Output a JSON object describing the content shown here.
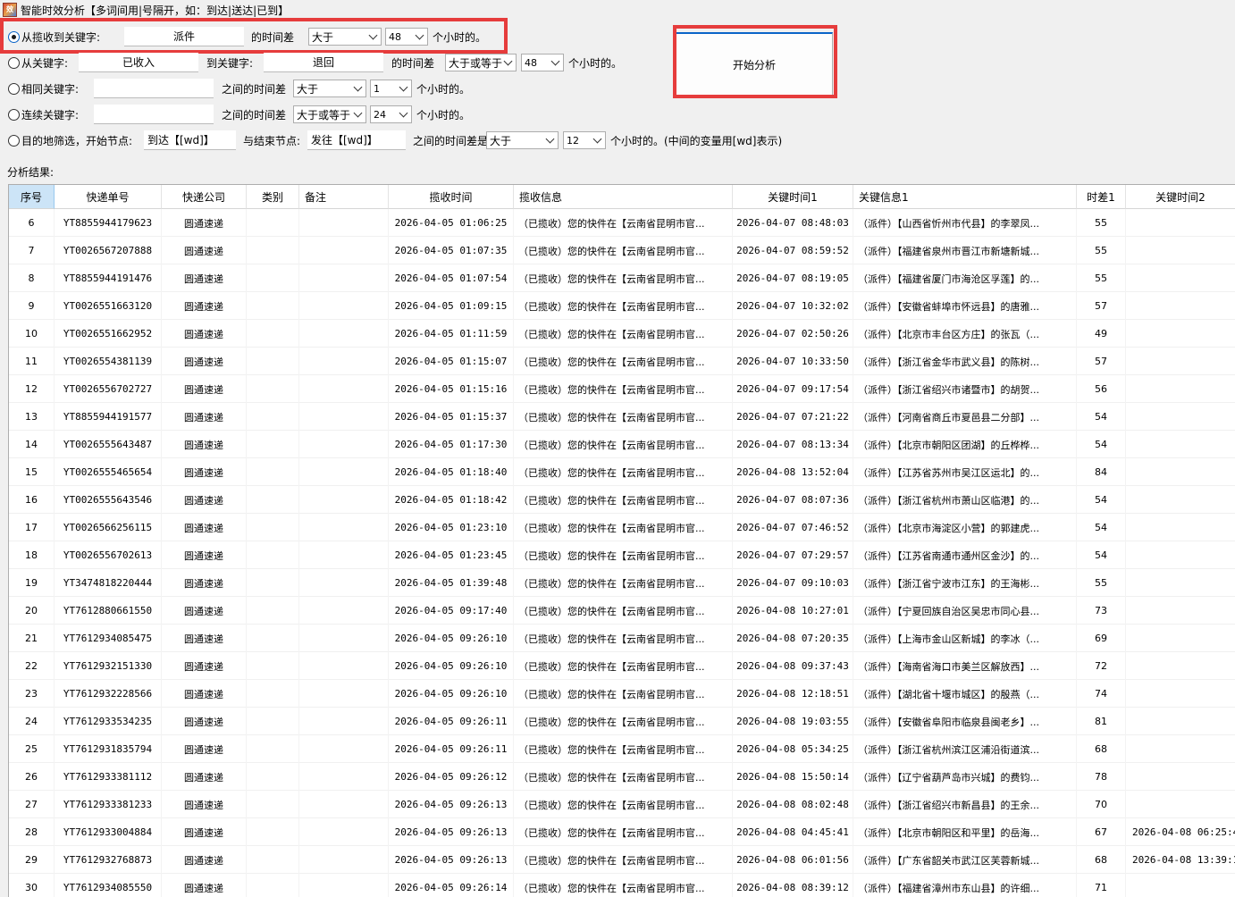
{
  "window": {
    "title": "智能时效分析【多词间用|号隔开，如：到达|送达|已到】",
    "icon_text": "效"
  },
  "row1": {
    "label": "从揽收到关键字:",
    "keyword": "派件",
    "diff_label": "的时间差",
    "op": "大于",
    "hours": "48",
    "unit": "个小时的。",
    "checked": true
  },
  "row2": {
    "label": "从关键字:",
    "from_keyword": "已收入",
    "to_label": "到关键字:",
    "to_keyword": "退回",
    "diff_label": "的时间差",
    "op": "大于或等于",
    "hours": "48",
    "unit": "个小时的。",
    "checked": false
  },
  "row3": {
    "label": "相同关键字:",
    "keyword": "",
    "diff_label": "之间的时间差",
    "op": "大于",
    "hours": "1",
    "unit": "个小时的。",
    "checked": false
  },
  "row4": {
    "label": "连续关键字:",
    "keyword": "",
    "diff_label": "之间的时间差",
    "op": "大于或等于",
    "hours": "24",
    "unit": "个小时的。",
    "checked": false
  },
  "row5": {
    "label": "目的地筛选，开始节点:",
    "start_node": "到达【[wd]】",
    "end_label": "与结束节点:",
    "end_node": "发往【[wd]】",
    "diff_label": "之间的时间差是",
    "op": "大于",
    "hours": "12",
    "unit": "个小时的。(中间的变量用[wd]表示)",
    "checked": false
  },
  "start_button": "开始分析",
  "results_label": "分析结果:",
  "columns": [
    "序号",
    "快递单号",
    "快递公司",
    "类别",
    "备注",
    "揽收时间",
    "揽收信息",
    "关键时间1",
    "关键信息1",
    "时差1",
    "关键时间2"
  ],
  "rows": [
    [
      "6",
      "YT8855944179623",
      "圆通速递",
      "",
      "",
      "2026-04-05 01:06:25",
      "（已揽收）您的快件在【云南省昆明市官...",
      "2026-04-07 08:48:03",
      "（派件）【山西省忻州市代县】的李翠凤...",
      "55",
      ""
    ],
    [
      "7",
      "YT0026567207888",
      "圆通速递",
      "",
      "",
      "2026-04-05 01:07:35",
      "（已揽收）您的快件在【云南省昆明市官...",
      "2026-04-07 08:59:52",
      "（派件）【福建省泉州市晋江市新塘新城...",
      "55",
      ""
    ],
    [
      "8",
      "YT8855944191476",
      "圆通速递",
      "",
      "",
      "2026-04-05 01:07:54",
      "（已揽收）您的快件在【云南省昆明市官...",
      "2026-04-07 08:19:05",
      "（派件）【福建省厦门市海沧区孚莲】的...",
      "55",
      ""
    ],
    [
      "9",
      "YT0026551663120",
      "圆通速递",
      "",
      "",
      "2026-04-05 01:09:15",
      "（已揽收）您的快件在【云南省昆明市官...",
      "2026-04-07 10:32:02",
      "（派件）【安徽省蚌埠市怀远县】的唐雅...",
      "57",
      ""
    ],
    [
      "10",
      "YT0026551662952",
      "圆通速递",
      "",
      "",
      "2026-04-05 01:11:59",
      "（已揽收）您的快件在【云南省昆明市官...",
      "2026-04-07 02:50:26",
      "（派件）【北京市丰台区方庄】的张瓦（...",
      "49",
      ""
    ],
    [
      "11",
      "YT0026554381139",
      "圆通速递",
      "",
      "",
      "2026-04-05 01:15:07",
      "（已揽收）您的快件在【云南省昆明市官...",
      "2026-04-07 10:33:50",
      "（派件）【浙江省金华市武义县】的陈树...",
      "57",
      ""
    ],
    [
      "12",
      "YT0026556702727",
      "圆通速递",
      "",
      "",
      "2026-04-05 01:15:16",
      "（已揽收）您的快件在【云南省昆明市官...",
      "2026-04-07 09:17:54",
      "（派件）【浙江省绍兴市诸暨市】的胡贺...",
      "56",
      ""
    ],
    [
      "13",
      "YT8855944191577",
      "圆通速递",
      "",
      "",
      "2026-04-05 01:15:37",
      "（已揽收）您的快件在【云南省昆明市官...",
      "2026-04-07 07:21:22",
      "（派件）【河南省商丘市夏邑县二分部】...",
      "54",
      ""
    ],
    [
      "14",
      "YT0026555643487",
      "圆通速递",
      "",
      "",
      "2026-04-05 01:17:30",
      "（已揽收）您的快件在【云南省昆明市官...",
      "2026-04-07 08:13:34",
      "（派件）【北京市朝阳区团湖】的丘桦桦...",
      "54",
      ""
    ],
    [
      "15",
      "YT0026555465654",
      "圆通速递",
      "",
      "",
      "2026-04-05 01:18:40",
      "（已揽收）您的快件在【云南省昆明市官...",
      "2026-04-08 13:52:04",
      "（派件）【江苏省苏州市吴江区运北】的...",
      "84",
      ""
    ],
    [
      "16",
      "YT0026555643546",
      "圆通速递",
      "",
      "",
      "2026-04-05 01:18:42",
      "（已揽收）您的快件在【云南省昆明市官...",
      "2026-04-07 08:07:36",
      "（派件）【浙江省杭州市萧山区临港】的...",
      "54",
      ""
    ],
    [
      "17",
      "YT0026566256115",
      "圆通速递",
      "",
      "",
      "2026-04-05 01:23:10",
      "（已揽收）您的快件在【云南省昆明市官...",
      "2026-04-07 07:46:52",
      "（派件）【北京市海淀区小营】的郭建虎...",
      "54",
      ""
    ],
    [
      "18",
      "YT0026556702613",
      "圆通速递",
      "",
      "",
      "2026-04-05 01:23:45",
      "（已揽收）您的快件在【云南省昆明市官...",
      "2026-04-07 07:29:57",
      "（派件）【江苏省南通市通州区金沙】的...",
      "54",
      ""
    ],
    [
      "19",
      "YT3474818220444",
      "圆通速递",
      "",
      "",
      "2026-04-05 01:39:48",
      "（已揽收）您的快件在【云南省昆明市官...",
      "2026-04-07 09:10:03",
      "（派件）【浙江省宁波市江东】的王海彬...",
      "55",
      ""
    ],
    [
      "20",
      "YT7612880661550",
      "圆通速递",
      "",
      "",
      "2026-04-05 09:17:40",
      "（已揽收）您的快件在【云南省昆明市官...",
      "2026-04-08 10:27:01",
      "（派件）【宁夏回族自治区吴忠市同心县...",
      "73",
      ""
    ],
    [
      "21",
      "YT7612934085475",
      "圆通速递",
      "",
      "",
      "2026-04-05 09:26:10",
      "（已揽收）您的快件在【云南省昆明市官...",
      "2026-04-08 07:20:35",
      "（派件）【上海市金山区新城】的李冰（...",
      "69",
      ""
    ],
    [
      "22",
      "YT7612932151330",
      "圆通速递",
      "",
      "",
      "2026-04-05 09:26:10",
      "（已揽收）您的快件在【云南省昆明市官...",
      "2026-04-08 09:37:43",
      "（派件）【海南省海口市美兰区解放西】...",
      "72",
      ""
    ],
    [
      "23",
      "YT7612932228566",
      "圆通速递",
      "",
      "",
      "2026-04-05 09:26:10",
      "（已揽收）您的快件在【云南省昆明市官...",
      "2026-04-08 12:18:51",
      "（派件）【湖北省十堰市城区】的殷燕（...",
      "74",
      ""
    ],
    [
      "24",
      "YT7612933534235",
      "圆通速递",
      "",
      "",
      "2026-04-05 09:26:11",
      "（已揽收）您的快件在【云南省昆明市官...",
      "2026-04-08 19:03:55",
      "（派件）【安徽省阜阳市临泉县闽老乡】...",
      "81",
      ""
    ],
    [
      "25",
      "YT7612931835794",
      "圆通速递",
      "",
      "",
      "2026-04-05 09:26:11",
      "（已揽收）您的快件在【云南省昆明市官...",
      "2026-04-08 05:34:25",
      "（派件）【浙江省杭州滨江区浦沿街道滨...",
      "68",
      ""
    ],
    [
      "26",
      "YT7612933381112",
      "圆通速递",
      "",
      "",
      "2026-04-05 09:26:12",
      "（已揽收）您的快件在【云南省昆明市官...",
      "2026-04-08 15:50:14",
      "（派件）【辽宁省葫芦岛市兴城】的费钧...",
      "78",
      ""
    ],
    [
      "27",
      "YT7612933381233",
      "圆通速递",
      "",
      "",
      "2026-04-05 09:26:13",
      "（已揽收）您的快件在【云南省昆明市官...",
      "2026-04-08 08:02:48",
      "（派件）【浙江省绍兴市新昌县】的王余...",
      "70",
      ""
    ],
    [
      "28",
      "YT7612933004884",
      "圆通速递",
      "",
      "",
      "2026-04-05 09:26:13",
      "（已揽收）您的快件在【云南省昆明市官...",
      "2026-04-08 04:45:41",
      "（派件）【北京市朝阳区和平里】的岳海...",
      "67",
      "2026-04-08 06:25:4"
    ],
    [
      "29",
      "YT7612932768873",
      "圆通速递",
      "",
      "",
      "2026-04-05 09:26:13",
      "（已揽收）您的快件在【云南省昆明市官...",
      "2026-04-08 06:01:56",
      "（派件）【广东省韶关市武江区芙蓉新城...",
      "68",
      "2026-04-08 13:39:1"
    ],
    [
      "30",
      "YT7612934085550",
      "圆通速递",
      "",
      "",
      "2026-04-05 09:26:14",
      "（已揽收）您的快件在【云南省昆明市官...",
      "2026-04-08 08:39:12",
      "（派件）【福建省漳州市东山县】的许细...",
      "71",
      ""
    ]
  ],
  "colors": {
    "highlight_red": "#e63c3c",
    "accent_blue": "#0a64c8",
    "header_selected": "#cce4f7"
  }
}
